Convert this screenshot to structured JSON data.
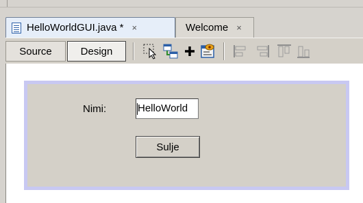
{
  "tabs": [
    {
      "label": "HelloWorldGUI.java *",
      "close": "×",
      "icon": "java-file-icon"
    },
    {
      "label": "Welcome",
      "close": "×"
    }
  ],
  "toolbar": {
    "source_label": "Source",
    "design_label": "Design",
    "icons": [
      "selection-mode-icon",
      "connection-mode-icon",
      "add-icon",
      "preview-design-icon",
      "align-left-icon",
      "align-right-icon",
      "align-top-icon",
      "align-bottom-icon"
    ]
  },
  "form": {
    "name_label": "Nimi:",
    "name_value": "HelloWorld",
    "close_button": "Sulje"
  },
  "colors": {
    "tab_active_bg": "#e6eef9",
    "form_border": "#c8c8f2",
    "form_bg": "#d4d0c8",
    "chrome_bg": "#d6d3ce"
  }
}
